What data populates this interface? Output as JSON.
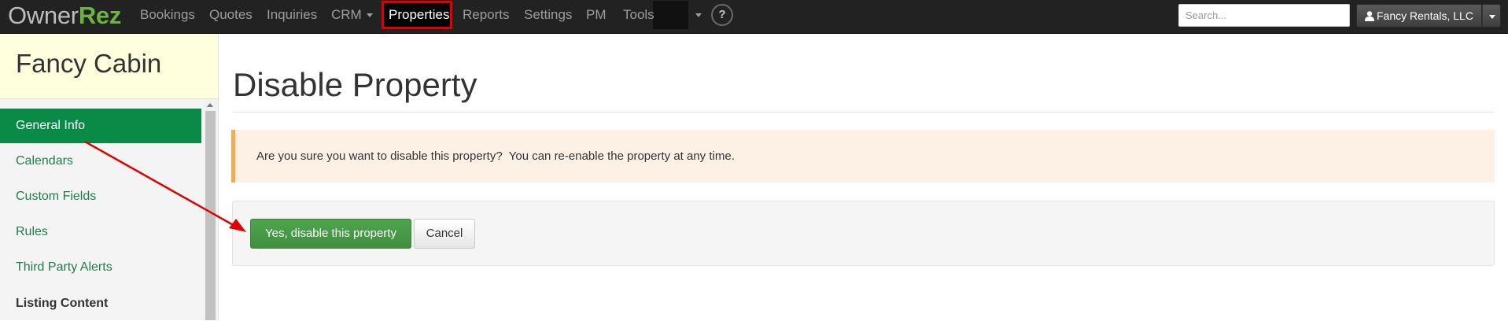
{
  "app": {
    "logo_owner": "Owner",
    "logo_rez": "Rez"
  },
  "nav": {
    "items": [
      {
        "label": "Bookings"
      },
      {
        "label": "Quotes"
      },
      {
        "label": "Inquiries"
      },
      {
        "label": "CRM",
        "has_dropdown": true
      },
      {
        "label": "Properties",
        "active": true
      },
      {
        "label": "Reports"
      },
      {
        "label": "Settings"
      },
      {
        "label": "PM"
      },
      {
        "label": "Tools",
        "has_dropdown": true
      }
    ],
    "help_label": "?",
    "search_placeholder": "Search...",
    "search_value": "",
    "account_label": "Fancy Rentals, LLC"
  },
  "sidebar": {
    "property_name": "Fancy Cabin",
    "items": [
      {
        "label": "General Info",
        "active": true
      },
      {
        "label": "Calendars"
      },
      {
        "label": "Custom Fields"
      },
      {
        "label": "Rules"
      },
      {
        "label": "Third Party Alerts"
      }
    ],
    "section_heading": "Listing Content"
  },
  "main": {
    "title": "Disable Property",
    "alert_text": "Are you sure you want to disable this property?  You can re-enable the property at any time.",
    "confirm_button": "Yes, disable this property",
    "cancel_button": "Cancel"
  },
  "colors": {
    "navbar_bg": "#222222",
    "brand_green": "#6db33f",
    "sidebar_active": "#0a8a47",
    "sidebar_link": "#1f7d4a",
    "property_header_bg": "#ffffdd",
    "alert_bg": "#fcf1e4",
    "alert_border": "#f0ad4e",
    "confirm_button": "#449d44",
    "highlight_box": "#e00000",
    "annotation_arrow": "#e00000"
  }
}
